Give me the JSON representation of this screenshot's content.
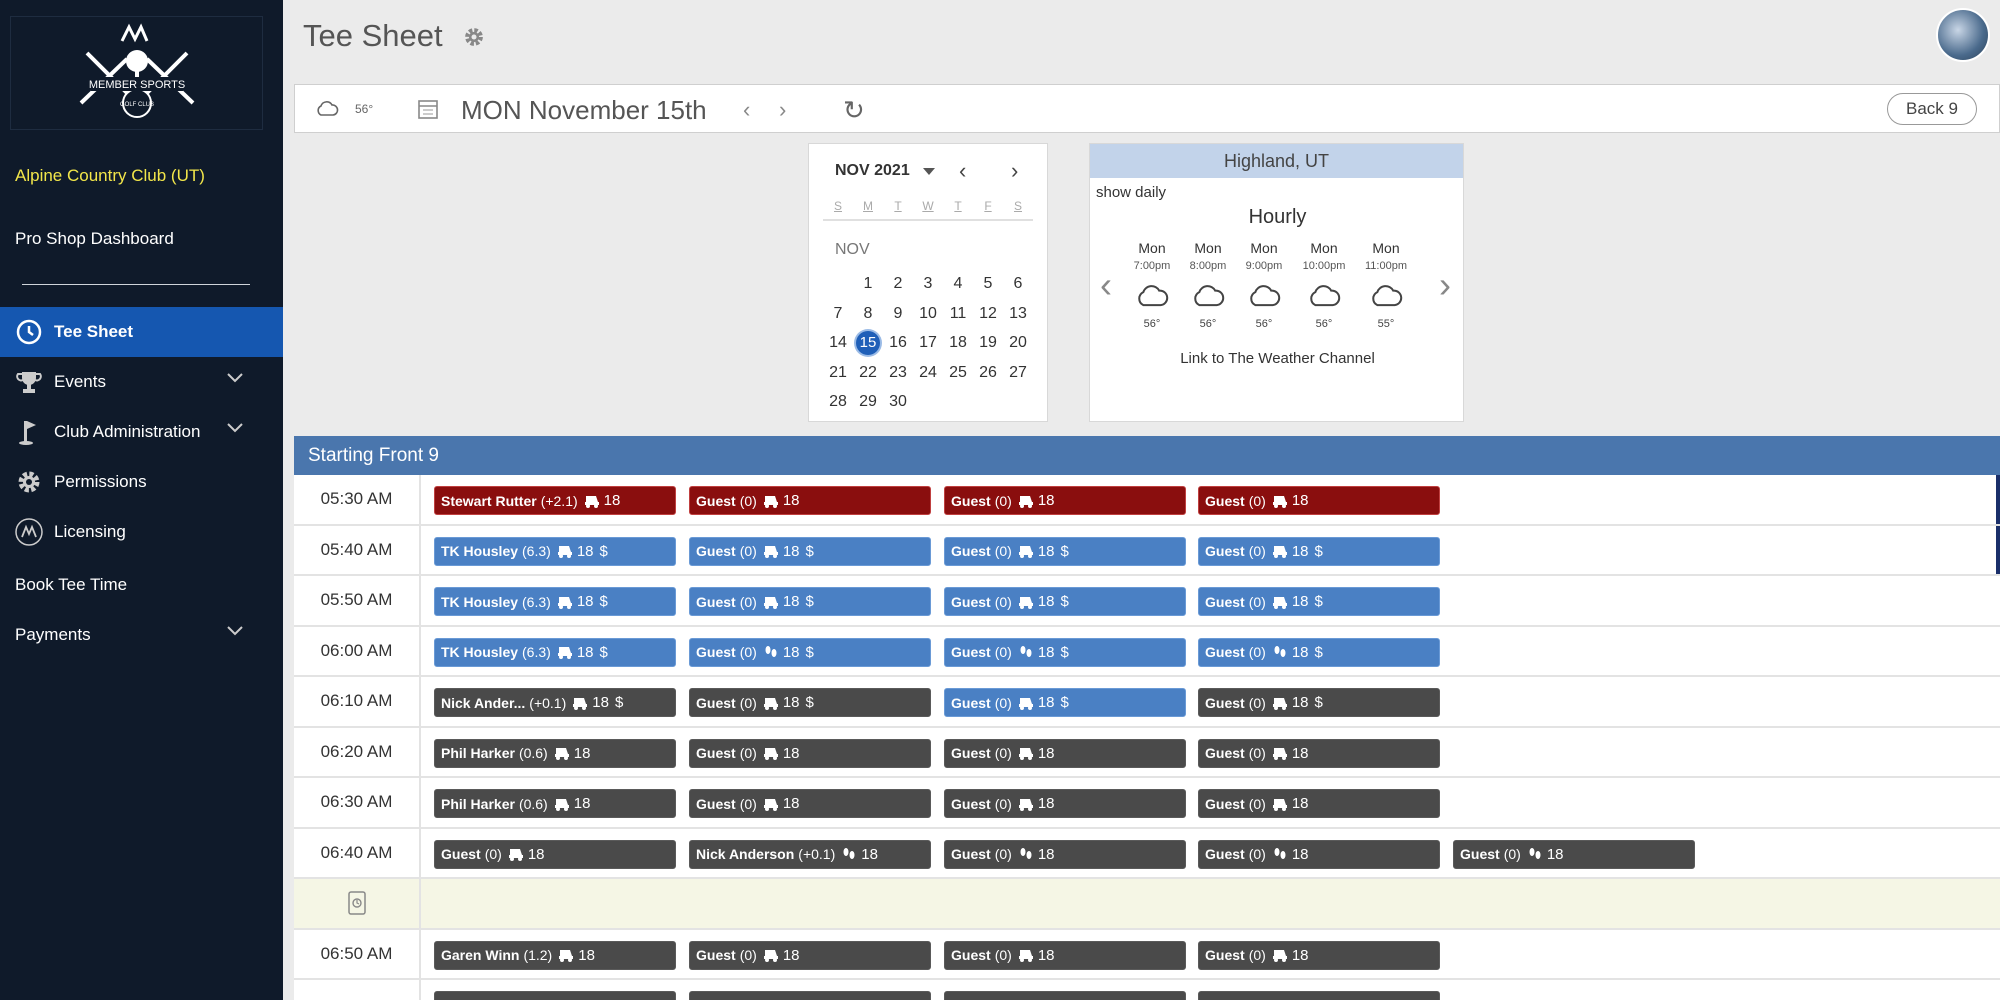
{
  "sidebar": {
    "logo_text": "MEMBER SPORTS",
    "logo_sub": "GOLF CLUB",
    "club_name": "Alpine Country Club (UT)",
    "pro_shop": "Pro Shop Dashboard",
    "nav": [
      {
        "label": "Tee Sheet",
        "icon": "clock-icon",
        "active": true
      },
      {
        "label": "Events",
        "icon": "trophy-icon"
      },
      {
        "label": "Club Administration",
        "icon": "golf-flag-icon"
      },
      {
        "label": "Permissions",
        "icon": "gear-icon"
      },
      {
        "label": "Licensing",
        "icon": "member-sports-logo-icon"
      },
      {
        "label": "Book Tee Time"
      },
      {
        "label": "Payments"
      }
    ]
  },
  "header": {
    "title": "Tee Sheet"
  },
  "datebar": {
    "temp": "56°",
    "date": "MON November 15th",
    "back_label": "Back 9"
  },
  "calendar": {
    "month_year": "NOV 2021",
    "dow": [
      "S",
      "M",
      "T",
      "W",
      "T",
      "F",
      "S"
    ],
    "month_label": "NOV",
    "selected": 15
  },
  "weather": {
    "location": "Highland, UT",
    "show_daily": "show daily",
    "mode": "Hourly",
    "hours": [
      {
        "day": "Mon",
        "time": "7:00pm",
        "temp": "56°"
      },
      {
        "day": "Mon",
        "time": "8:00pm",
        "temp": "56°"
      },
      {
        "day": "Mon",
        "time": "9:00pm",
        "temp": "56°"
      },
      {
        "day": "Mon",
        "time": "10:00pm",
        "temp": "56°"
      },
      {
        "day": "Mon",
        "time": "11:00pm",
        "temp": "55°"
      }
    ],
    "link": "Link to The Weather Channel"
  },
  "tee_sheet": {
    "section": "Starting Front 9",
    "colors": {
      "red": "#8a0e0e",
      "blue": "#4a80c4",
      "dark": "#4a4a4a"
    },
    "rows": [
      {
        "time": "05:30 AM",
        "slots": [
          {
            "name": "Stewart Rutter",
            "hc": "(+2.1)",
            "transport": "cart",
            "holes": "18",
            "paid": "",
            "color": "red"
          },
          {
            "name": "Guest",
            "hc": "(0)",
            "transport": "cart",
            "holes": "18",
            "paid": "",
            "color": "red"
          },
          {
            "name": "Guest",
            "hc": "(0)",
            "transport": "cart",
            "holes": "18",
            "paid": "",
            "color": "red"
          },
          {
            "name": "Guest",
            "hc": "(0)",
            "transport": "cart",
            "holes": "18",
            "paid": "",
            "color": "red"
          }
        ]
      },
      {
        "time": "05:40 AM",
        "slots": [
          {
            "name": "TK Housley",
            "hc": "(6.3)",
            "transport": "cart",
            "holes": "18",
            "paid": "$",
            "color": "blue"
          },
          {
            "name": "Guest",
            "hc": "(0)",
            "transport": "cart",
            "holes": "18",
            "paid": "$",
            "color": "blue"
          },
          {
            "name": "Guest",
            "hc": "(0)",
            "transport": "cart",
            "holes": "18",
            "paid": "$",
            "color": "blue"
          },
          {
            "name": "Guest",
            "hc": "(0)",
            "transport": "cart",
            "holes": "18",
            "paid": "$",
            "color": "blue"
          }
        ]
      },
      {
        "time": "05:50 AM",
        "slots": [
          {
            "name": "TK Housley",
            "hc": "(6.3)",
            "transport": "cart",
            "holes": "18",
            "paid": "$",
            "color": "blue"
          },
          {
            "name": "Guest",
            "hc": "(0)",
            "transport": "cart",
            "holes": "18",
            "paid": "$",
            "color": "blue"
          },
          {
            "name": "Guest",
            "hc": "(0)",
            "transport": "cart",
            "holes": "18",
            "paid": "$",
            "color": "blue"
          },
          {
            "name": "Guest",
            "hc": "(0)",
            "transport": "cart",
            "holes": "18",
            "paid": "$",
            "color": "blue"
          }
        ]
      },
      {
        "time": "06:00 AM",
        "slots": [
          {
            "name": "TK Housley",
            "hc": "(6.3)",
            "transport": "cart",
            "holes": "18",
            "paid": "$",
            "color": "blue"
          },
          {
            "name": "Guest",
            "hc": "(0)",
            "transport": "walk",
            "holes": "18",
            "paid": "$",
            "color": "blue"
          },
          {
            "name": "Guest",
            "hc": "(0)",
            "transport": "walk",
            "holes": "18",
            "paid": "$",
            "color": "blue"
          },
          {
            "name": "Guest",
            "hc": "(0)",
            "transport": "walk",
            "holes": "18",
            "paid": "$",
            "color": "blue"
          }
        ]
      },
      {
        "time": "06:10 AM",
        "slots": [
          {
            "name": "Nick Ander...",
            "hc": "(+0.1)",
            "transport": "cart",
            "holes": "18",
            "paid": "$",
            "color": "dark"
          },
          {
            "name": "Guest",
            "hc": "(0)",
            "transport": "cart",
            "holes": "18",
            "paid": "$",
            "color": "dark"
          },
          {
            "name": "Guest",
            "hc": "(0)",
            "transport": "cart",
            "holes": "18",
            "paid": "$",
            "color": "blue"
          },
          {
            "name": "Guest",
            "hc": "(0)",
            "transport": "cart",
            "holes": "18",
            "paid": "$",
            "color": "dark"
          }
        ]
      },
      {
        "time": "06:20 AM",
        "slots": [
          {
            "name": "Phil Harker",
            "hc": "(0.6)",
            "transport": "cart",
            "holes": "18",
            "paid": "",
            "color": "dark"
          },
          {
            "name": "Guest",
            "hc": "(0)",
            "transport": "cart",
            "holes": "18",
            "paid": "",
            "color": "dark"
          },
          {
            "name": "Guest",
            "hc": "(0)",
            "transport": "cart",
            "holes": "18",
            "paid": "",
            "color": "dark"
          },
          {
            "name": "Guest",
            "hc": "(0)",
            "transport": "cart",
            "holes": "18",
            "paid": "",
            "color": "dark"
          }
        ]
      },
      {
        "time": "06:30 AM",
        "slots": [
          {
            "name": "Phil Harker",
            "hc": "(0.6)",
            "transport": "cart",
            "holes": "18",
            "paid": "",
            "color": "dark"
          },
          {
            "name": "Guest",
            "hc": "(0)",
            "transport": "cart",
            "holes": "18",
            "paid": "",
            "color": "dark"
          },
          {
            "name": "Guest",
            "hc": "(0)",
            "transport": "cart",
            "holes": "18",
            "paid": "",
            "color": "dark"
          },
          {
            "name": "Guest",
            "hc": "(0)",
            "transport": "cart",
            "holes": "18",
            "paid": "",
            "color": "dark"
          }
        ]
      },
      {
        "time": "06:40 AM",
        "slots": [
          {
            "name": "Guest",
            "hc": "(0)",
            "transport": "cart",
            "holes": "18",
            "paid": "",
            "color": "dark"
          },
          {
            "name": "Nick Anderson",
            "hc": "(+0.1)",
            "transport": "walk",
            "holes": "18",
            "paid": "",
            "color": "dark"
          },
          {
            "name": "Guest",
            "hc": "(0)",
            "transport": "walk",
            "holes": "18",
            "paid": "",
            "color": "dark"
          },
          {
            "name": "Guest",
            "hc": "(0)",
            "transport": "walk",
            "holes": "18",
            "paid": "",
            "color": "dark"
          },
          {
            "name": "Guest",
            "hc": "(0)",
            "transport": "walk",
            "holes": "18",
            "paid": "",
            "color": "dark"
          }
        ]
      },
      {
        "time": "",
        "blocked": true,
        "slots": []
      },
      {
        "time": "06:50 AM",
        "slots": [
          {
            "name": "Garen Winn",
            "hc": "(1.2)",
            "transport": "cart",
            "holes": "18",
            "paid": "",
            "color": "dark"
          },
          {
            "name": "Guest",
            "hc": "(0)",
            "transport": "cart",
            "holes": "18",
            "paid": "",
            "color": "dark"
          },
          {
            "name": "Guest",
            "hc": "(0)",
            "transport": "cart",
            "holes": "18",
            "paid": "",
            "color": "dark"
          },
          {
            "name": "Guest",
            "hc": "(0)",
            "transport": "cart",
            "holes": "18",
            "paid": "",
            "color": "dark"
          }
        ]
      },
      {
        "time": "",
        "slots": [
          {
            "name": "",
            "hc": "",
            "transport": "",
            "holes": "",
            "paid": "",
            "color": "dark"
          },
          {
            "name": "",
            "hc": "",
            "transport": "",
            "holes": "",
            "paid": "",
            "color": "dark"
          },
          {
            "name": "",
            "hc": "",
            "transport": "",
            "holes": "",
            "paid": "",
            "color": "dark"
          },
          {
            "name": "",
            "hc": "",
            "transport": "",
            "holes": "",
            "paid": "",
            "color": "dark"
          }
        ]
      }
    ]
  }
}
